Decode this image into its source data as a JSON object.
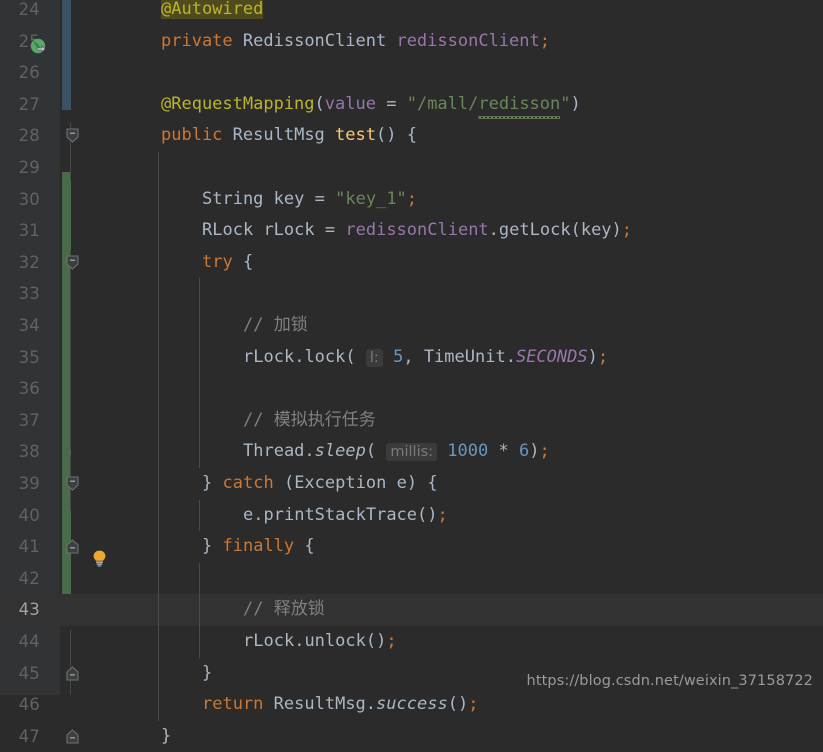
{
  "editor": {
    "theme": "darcula",
    "background": "#2b2b2b",
    "gutter_background": "#313335",
    "current_line_background": "#323232",
    "first_line_number": 24,
    "last_line_number": 47
  },
  "watermark": {
    "text": "https://blog.csdn.net/weixin_37158722"
  },
  "gutter": {
    "bean_icon_line": 25,
    "bean_icon_name": "spring-bean-navigation-icon",
    "bulb_icon_line": 43,
    "bulb_icon_name": "intention-bulb-icon",
    "fold_collapse_lines": [
      28,
      32,
      39
    ],
    "fold_end_lines": [
      41,
      45,
      47
    ],
    "change_bar_blue_lines": [
      24,
      25,
      26,
      27
    ],
    "change_bar_green_lines": [
      30,
      31,
      32,
      33,
      34,
      35,
      36,
      37,
      38,
      39,
      40,
      41,
      42,
      43,
      44,
      45
    ]
  },
  "lines": [
    {
      "n": 24,
      "text": "    @Autowired"
    },
    {
      "n": 25,
      "text": "    private RedissonClient redissonClient;"
    },
    {
      "n": 26,
      "text": ""
    },
    {
      "n": 27,
      "text": "    @RequestMapping(value = \"/mall/redisson\")"
    },
    {
      "n": 28,
      "text": "    public ResultMsg test() {"
    },
    {
      "n": 29,
      "text": ""
    },
    {
      "n": 30,
      "text": "        String key = \"key_1\";"
    },
    {
      "n": 31,
      "text": "        RLock rLock = redissonClient.getLock(key);"
    },
    {
      "n": 32,
      "text": "        try {"
    },
    {
      "n": 33,
      "text": ""
    },
    {
      "n": 34,
      "text": "            // 加锁"
    },
    {
      "n": 35,
      "text": "            rLock.lock( l: 5, TimeUnit.SECONDS);"
    },
    {
      "n": 36,
      "text": ""
    },
    {
      "n": 37,
      "text": "            // 模拟执行任务"
    },
    {
      "n": 38,
      "text": "            Thread.sleep( millis: 1000 * 6);"
    },
    {
      "n": 39,
      "text": "        } catch (Exception e) {"
    },
    {
      "n": 40,
      "text": "            e.printStackTrace();"
    },
    {
      "n": 41,
      "text": "        } finally {"
    },
    {
      "n": 42,
      "text": ""
    },
    {
      "n": 43,
      "text": "            // 释放锁"
    },
    {
      "n": 44,
      "text": "            rLock.unlock();"
    },
    {
      "n": 45,
      "text": "        }"
    },
    {
      "n": 46,
      "text": "        return ResultMsg.success();"
    },
    {
      "n": 47,
      "text": "    }"
    }
  ],
  "inline_hints": [
    {
      "line": 35,
      "label": "l:"
    },
    {
      "line": 38,
      "label": "millis:"
    }
  ],
  "spellcheck_warnings": [
    {
      "line": 27,
      "word": "redisson"
    }
  ],
  "highlights": [
    {
      "line": 24,
      "token": "@Autowired",
      "color": "#4f4b1f"
    }
  ],
  "colors": {
    "keyword": "#cc7832",
    "string": "#6a8759",
    "number": "#6897bb",
    "annotation": "#bbb529",
    "comment": "#808080",
    "field": "#9876aa",
    "identifier": "#a9b7c6",
    "method_declaration": "#ffc66d",
    "line_number": "#606366",
    "line_number_active": "#a4a3a3",
    "change_bar_blue": "#3a5263",
    "change_bar_green": "#4a6b4a",
    "bulb": "#f0a732",
    "bean": "#59a869"
  },
  "line_numbers": [
    24,
    25,
    26,
    27,
    28,
    29,
    30,
    31,
    32,
    33,
    34,
    35,
    36,
    37,
    38,
    39,
    40,
    41,
    42,
    43,
    44,
    45,
    46,
    47
  ]
}
